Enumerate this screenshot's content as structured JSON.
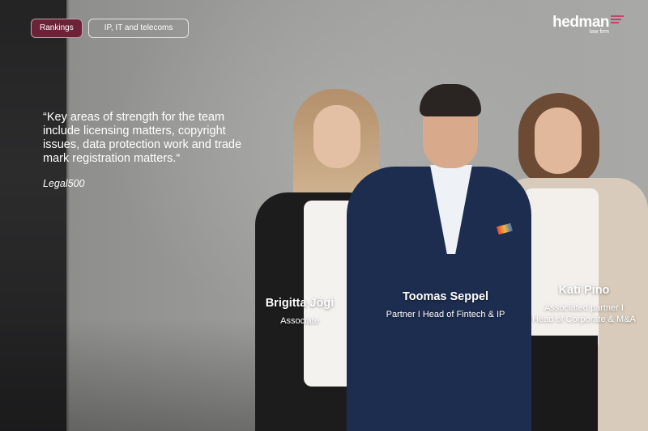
{
  "tabs": [
    {
      "label": "Rankings",
      "active": true
    },
    {
      "label": "IP, IT and telecoms",
      "active": false
    }
  ],
  "logo": {
    "word": "hedman",
    "sub": "law firm",
    "accent_color": "#b9486b"
  },
  "quote": {
    "text": "“Key areas of strength for the team include licensing matters, copyright issues, data protection work and trade mark registration matters.“",
    "source": "Legal500"
  },
  "people": [
    {
      "name": "Brigitta Jõgi",
      "role_lines": [
        "Associate"
      ]
    },
    {
      "name": "Toomas Seppel",
      "role_lines": [
        "Partner I Head of Fintech & IP"
      ]
    },
    {
      "name": "Kati Pino",
      "role_lines": [
        "Associated partner I",
        "Head of Corporate & M&A"
      ]
    }
  ],
  "colors": {
    "active_tab": "#6e2238"
  }
}
